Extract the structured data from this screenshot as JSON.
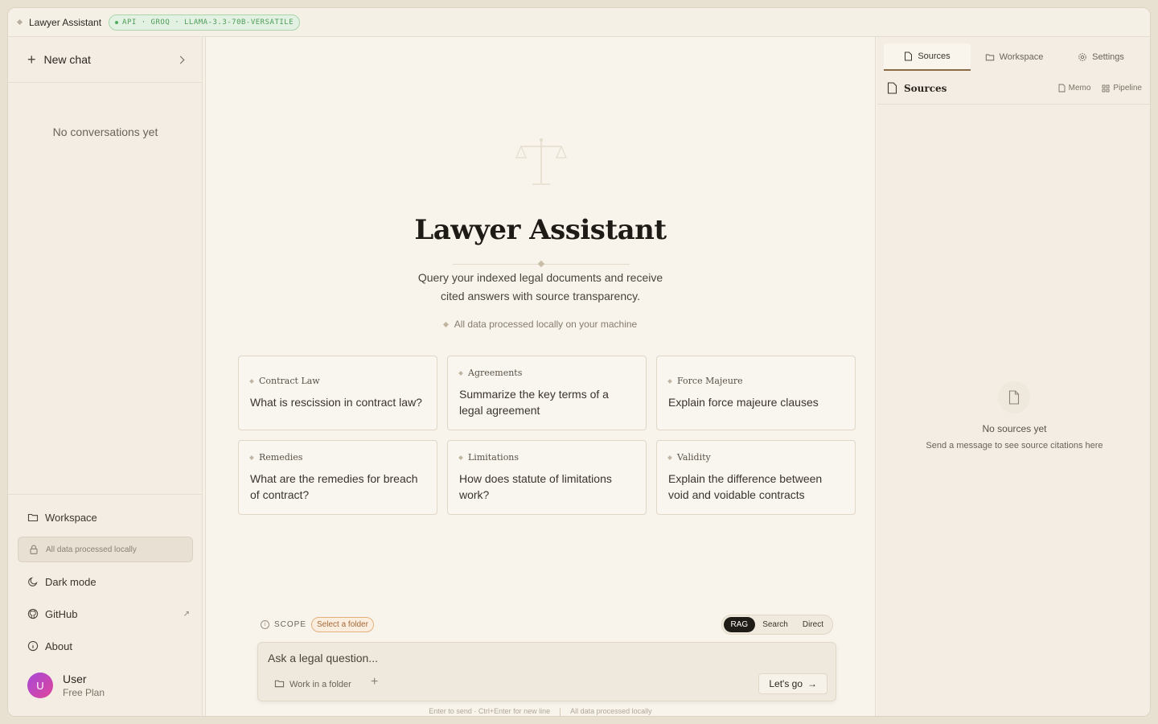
{
  "topbar": {
    "app_name": "Lawyer Assistant",
    "api_badge": "API · GROQ · LLAMA-3.3-70B-VERSATILE"
  },
  "sidebar": {
    "new_chat": "New chat",
    "empty": "No conversations yet",
    "items": [
      {
        "label": "Workspace",
        "icon": "folder-icon"
      },
      {
        "label": "All data processed locally",
        "icon": "lock-icon"
      },
      {
        "label": "Dark mode",
        "icon": "moon-icon"
      },
      {
        "label": "GitHub",
        "icon": "github-icon"
      },
      {
        "label": "About",
        "icon": "info-icon"
      }
    ],
    "user": {
      "initial": "U",
      "name": "User",
      "plan": "Free Plan"
    }
  },
  "main": {
    "title": "Lawyer Assistant",
    "subtitle_line1": "Query your indexed legal documents and receive",
    "subtitle_line2": "cited answers with source transparency.",
    "note": "All data processed locally on your machine",
    "cards": [
      {
        "category": "Contract Law",
        "question": "What is rescission in contract law?"
      },
      {
        "category": "Agreements",
        "question": "Summarize the key terms of a legal agreement"
      },
      {
        "category": "Force Majeure",
        "question": "Explain force majeure clauses"
      },
      {
        "category": "Remedies",
        "question": "What are the remedies for breach of contract?"
      },
      {
        "category": "Limitations",
        "question": "How does statute of limitations work?"
      },
      {
        "category": "Validity",
        "question": "Explain the difference between void and voidable contracts"
      }
    ],
    "scope_label": "SCOPE",
    "scope_pill": "Select a folder",
    "modes": [
      "RAG",
      "Search",
      "Direct"
    ],
    "active_mode": "RAG",
    "input_placeholder": "Ask a legal question...",
    "work_folder": "Work in a folder",
    "go_label": "Let's go",
    "hint_left": "Enter to send · Ctrl+Enter for new line",
    "hint_right": "All data processed locally"
  },
  "right": {
    "tabs": [
      "Sources",
      "Workspace",
      "Settings"
    ],
    "active_tab": "Sources",
    "header": "Sources",
    "tools": [
      "Memo",
      "Pipeline"
    ],
    "empty_title": "No sources yet",
    "empty_sub": "Send a message to see source citations here"
  }
}
